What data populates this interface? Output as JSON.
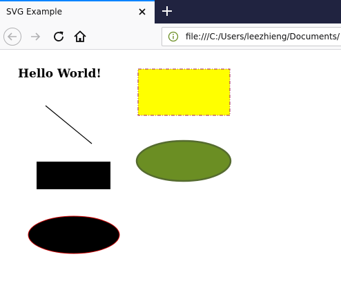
{
  "browser": {
    "tab": {
      "title": "SVG Example",
      "close_icon": "close-icon"
    },
    "new_tab_icon": "plus-icon",
    "nav": {
      "back_icon": "back-arrow-icon",
      "forward_icon": "forward-arrow-icon",
      "reload_icon": "reload-icon",
      "home_icon": "home-icon"
    },
    "url": {
      "info_icon": "info-icon",
      "value": "file:///C:/Users/leezhieng/Documents/"
    }
  },
  "page": {
    "heading": "Hello World!",
    "shapes": {
      "rectangle_fill": "#ffff00",
      "rectangle_stroke": "#a0205a",
      "ellipse_fill": "#6b8e23",
      "ellipse_stroke": "#556b2f",
      "black_ellipse_stroke": "#cc0000"
    }
  }
}
